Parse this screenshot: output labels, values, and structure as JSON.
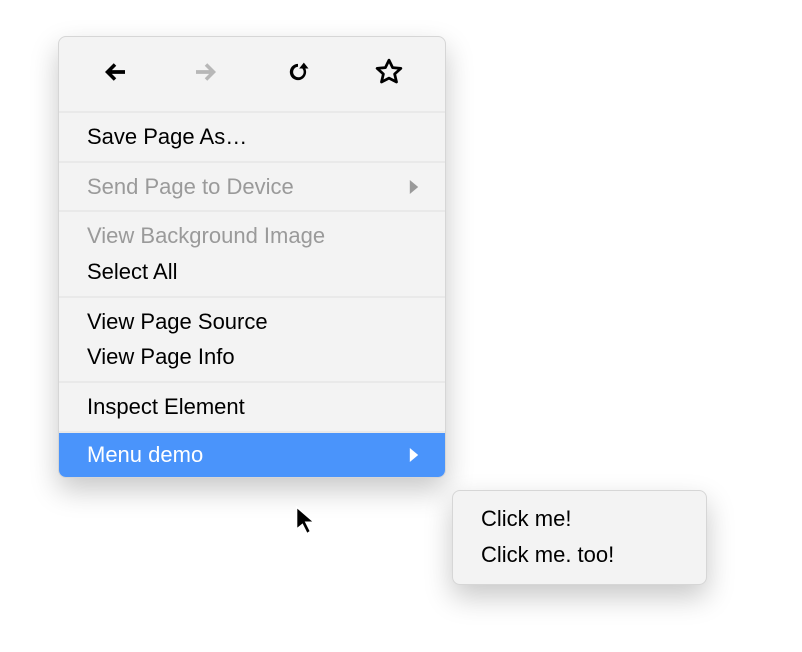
{
  "toolbar": {
    "back": "back-arrow-icon",
    "forward": "forward-arrow-icon",
    "reload": "reload-icon",
    "star": "star-icon"
  },
  "menu": {
    "save_as": "Save Page As…",
    "send_to_device": "Send Page to Device",
    "view_bg_image": "View Background Image",
    "select_all": "Select All",
    "view_source": "View Page Source",
    "view_info": "View Page Info",
    "inspect": "Inspect Element",
    "menu_demo": "Menu demo"
  },
  "submenu": {
    "click_me": "Click me!",
    "click_me_too": "Click me. too!"
  }
}
